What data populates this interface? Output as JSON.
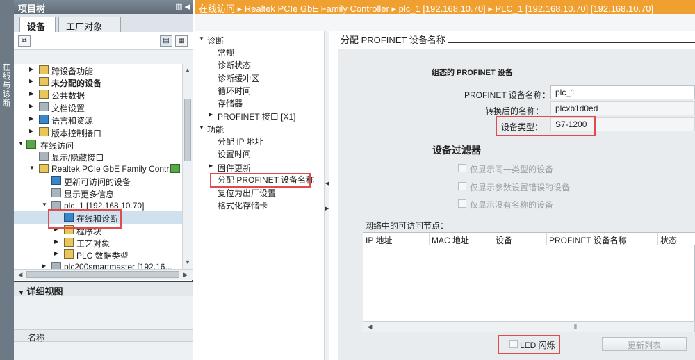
{
  "side_strip": {
    "label": "在线与诊断"
  },
  "project_tree": {
    "title": "项目树",
    "tabs": [
      "设备",
      "工厂对象"
    ],
    "items": [
      {
        "label": "跨设备功能",
        "bold": false
      },
      {
        "label": "未分配的设备",
        "bold": true
      },
      {
        "label": "公共数据",
        "bold": false
      },
      {
        "label": "文档设置",
        "bold": false
      },
      {
        "label": "语言和资源",
        "bold": false
      },
      {
        "label": "版本控制接口",
        "bold": false
      },
      {
        "label": "在线访问",
        "bold": false
      },
      {
        "label": "显示/隐藏接口",
        "bold": false
      },
      {
        "label": "Realtek PCIe GbE Family Contr...",
        "bold": false
      },
      {
        "label": "更新可访问的设备",
        "bold": false
      },
      {
        "label": "显示更多信息",
        "bold": false
      },
      {
        "label": "plc_1 [192.168.10.70]",
        "bold": false
      },
      {
        "label": "在线和诊断",
        "bold": false
      },
      {
        "label": "程序块",
        "bold": false
      },
      {
        "label": "工艺对象",
        "bold": false
      },
      {
        "label": "PLC 数据类型",
        "bold": false
      },
      {
        "label": "plc200smartmaster [192.16...",
        "bold": false
      }
    ]
  },
  "detail_view": {
    "title": "详细视图",
    "column": "名称"
  },
  "breadcrumb": [
    "在线访问",
    "Realtek PCIe GbE Family Controller",
    "plc_1 [192.168.10.70]",
    "PLC_1 [192.168.10.70] [192.168.10.70]"
  ],
  "nav": {
    "groups": [
      {
        "label": "诊断",
        "items": [
          "常规",
          "诊断状态",
          "诊断缓冲区",
          "循环时间",
          "存储器"
        ]
      },
      {
        "label": "PROFINET 接口 [X1]"
      },
      {
        "label": "功能",
        "items": [
          "分配 IP 地址",
          "设置时间"
        ]
      },
      {
        "label": "固件更新"
      },
      {
        "items": [
          "分配 PROFINET 设备名称",
          "复位为出厂设置",
          "格式化存储卡"
        ]
      }
    ]
  },
  "main": {
    "section_title": "分配 PROFINET 设备名称",
    "configured_heading": "组态的 PROFINET 设备",
    "device_name_label": "PROFINET 设备名称：",
    "device_name_value": "plc_1",
    "converted_name_label": "转换后的名称：",
    "converted_name_value": "plcxb1d0ed",
    "device_type_label": "设备类型：",
    "device_type_value": "S7-1200",
    "filter_heading": "设备过滤器",
    "filters": [
      "仅显示同一类型的设备",
      "仅显示参数设置错误的设备",
      "仅显示没有名称的设备"
    ],
    "network_nodes_label": "网络中的可访问节点：",
    "table_columns": [
      "IP 地址",
      "MAC 地址",
      "设备",
      "PROFINET 设备名称",
      "状态"
    ],
    "led_label": "LED 闪烁",
    "refresh_button": "更新列表"
  },
  "colors": {
    "online_bar": "#f0a030",
    "highlight": "#e24b4b",
    "header": "#5f6c78"
  }
}
